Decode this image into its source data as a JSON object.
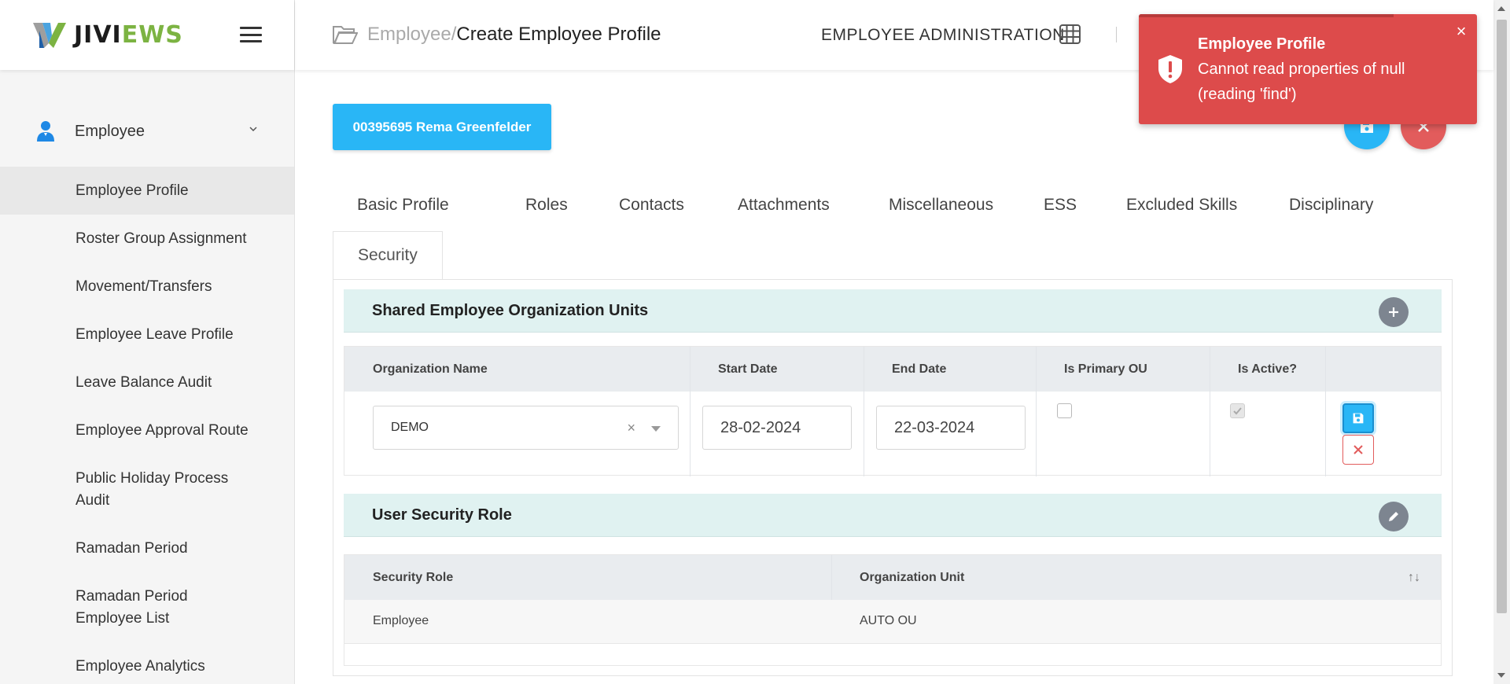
{
  "app": {
    "logo_prefix": "JIVI",
    "logo_suffix": "EWS"
  },
  "sidebar": {
    "group": {
      "label": "Employee",
      "icon": "person-icon"
    },
    "items": [
      {
        "label": "Employee Profile",
        "active": true
      },
      {
        "label": "Roster Group Assignment"
      },
      {
        "label": "Movement/Transfers"
      },
      {
        "label": "Employee Leave Profile"
      },
      {
        "label": "Leave Balance Audit"
      },
      {
        "label": "Employee Approval Route"
      },
      {
        "label": "Public Holiday Process Audit"
      },
      {
        "label": "Ramadan Period"
      },
      {
        "label": "Ramadan Period Employee List"
      },
      {
        "label": "Employee Analytics"
      }
    ]
  },
  "header": {
    "breadcrumb_parent": "Employee/",
    "breadcrumb_current": "Create Employee Profile",
    "module": "EMPLOYEE ADMINISTRATION"
  },
  "employee_chip": "00395695 Rema Greenfelder",
  "tabs": [
    "Basic Profile",
    "Roles",
    "Contacts",
    "Attachments",
    "Miscellaneous",
    "ESS",
    "Excluded Skills",
    "Disciplinary",
    "Security"
  ],
  "active_tab": "Security",
  "shared_ou": {
    "title": "Shared Employee Organization Units",
    "columns": [
      "Organization Name",
      "Start Date",
      "End Date",
      "Is Primary OU",
      "Is Active?"
    ],
    "row": {
      "organization": "DEMO",
      "start_date": "28-02-2024",
      "end_date": "22-03-2024",
      "is_primary": false,
      "is_active": true
    },
    "clear_glyph": "×"
  },
  "user_security_role": {
    "title": "User Security Role",
    "columns": [
      "Security Role",
      "Organization Unit"
    ],
    "sort_glyph": "↑↓",
    "rows": [
      {
        "role": "Employee",
        "org_unit": "AUTO OU"
      }
    ]
  },
  "toast": {
    "title": "Employee Profile",
    "message": "Cannot read properties of null (reading 'find')",
    "close_glyph": "×",
    "color": "#dd4b4b"
  },
  "colors": {
    "accent": "#29b6f6",
    "danger": "#e25c5c",
    "section_bg": "#e0f2f1"
  }
}
